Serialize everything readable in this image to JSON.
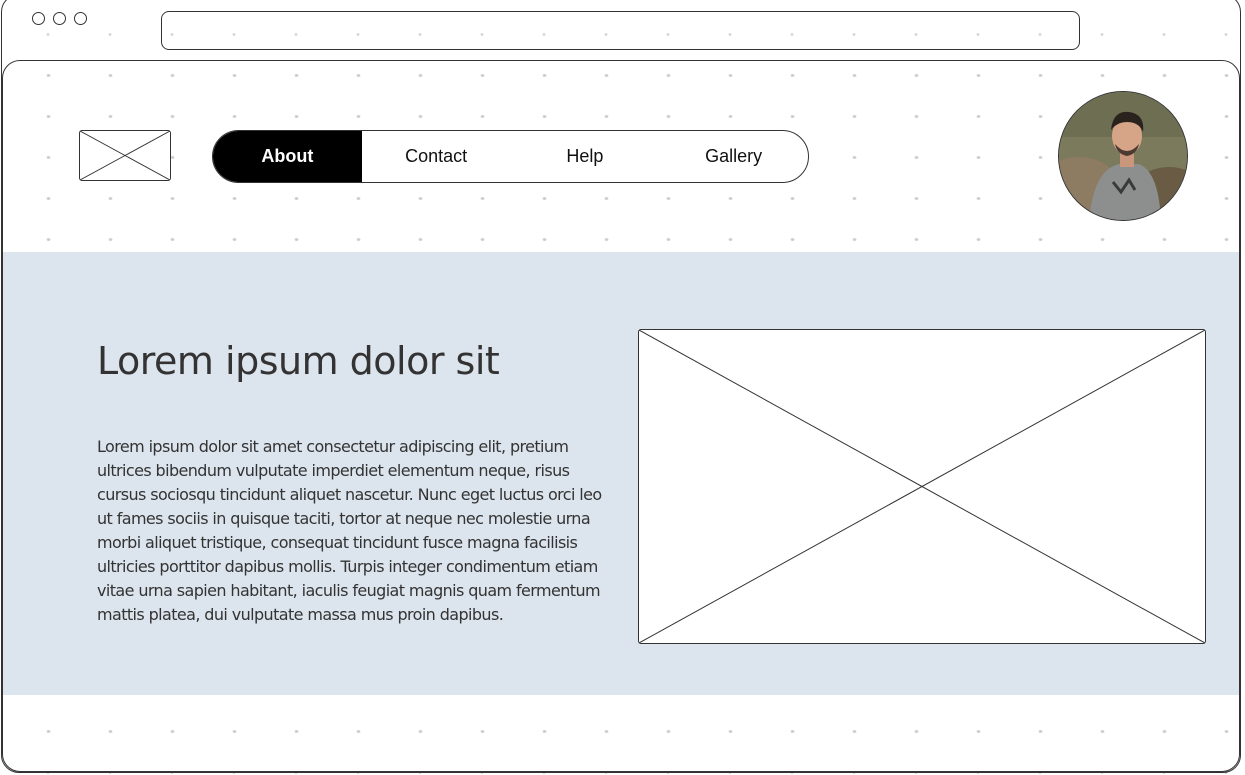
{
  "nav": {
    "items": [
      {
        "label": "About",
        "active": true
      },
      {
        "label": "Contact",
        "active": false
      },
      {
        "label": "Help",
        "active": false
      },
      {
        "label": "Gallery",
        "active": false
      }
    ]
  },
  "hero": {
    "title": "Lorem ipsum dolor sit",
    "body": "Lorem ipsum dolor sit amet consectetur adipiscing elit, pretium ultrices bibendum vulputate imperdiet elementum neque, risus cursus sociosqu tincidunt aliquet nascetur. Nunc eget luctus orci leo ut fames sociis in quisque taciti, tortor at neque nec molestie urna morbi aliquet tristique, consequat tincidunt fusce magna facilisis ultricies porttitor dapibus mollis. Turpis integer condimentum etiam vitae urna sapien habitant, iaculis feugiat magnis quam fermentum mattis platea, dui vulputate massa mus proin dapibus."
  },
  "colors": {
    "hero_background": "#dce4ed",
    "active_nav": "#000000",
    "outline": "#333333"
  },
  "icons": {
    "logo": "image-placeholder-icon",
    "hero_image": "image-placeholder-icon"
  }
}
